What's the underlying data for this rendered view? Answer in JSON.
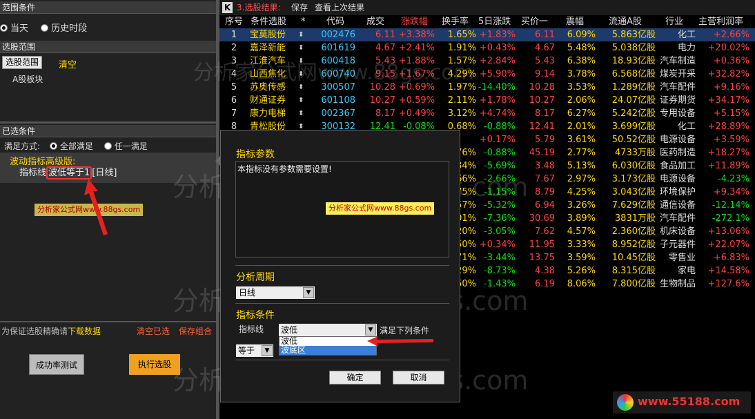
{
  "left": {
    "range_head": "范围条件",
    "range_options": [
      "当天",
      "历史时段"
    ],
    "stock_range_head": "选股范围",
    "stock_range_button": "选股范围",
    "clear_label": "清空",
    "board": "A股板块",
    "selected_head": "已选条件",
    "satisfy_label": "满足方式:",
    "satisfy_options": [
      "全部满足",
      "任一满足"
    ],
    "cond_title": "波动指标高级版:",
    "cond_prefix": "指标线",
    "cond_highlight": "波低等于1",
    "cond_suffix": "[日线]",
    "watermark_tag": "分析家公式网www.88gs.com",
    "note_text": "为保证选股精确请",
    "download_link": "下载数据",
    "clear_selected": "清空已选",
    "save_combo": "保存组合",
    "test_button": "成功率测试",
    "run_button": "执行选股"
  },
  "topbar": {
    "logo": "K",
    "title": "3.选股结果:",
    "save": "保存",
    "last": "查看上次结果"
  },
  "columns": [
    "序号",
    "条件选股",
    "*",
    "代码",
    "成交",
    "涨跌幅",
    "换手率",
    "5日涨跌",
    "买价一",
    "震幅",
    "流通A股",
    "行业",
    "主营利润率"
  ],
  "rows": [
    {
      "n": "1",
      "name": "宝莫股份",
      "code": "002476",
      "price": "6.11",
      "chg": "+3.38%",
      "turn": "1.65%",
      "d5": "+1.83%",
      "bid": "6.11",
      "amp": "6.09%",
      "float": "5.863亿股",
      "ind": "化工",
      "margin": "+2.66%"
    },
    {
      "n": "2",
      "name": "嘉泽新能",
      "code": "601619",
      "price": "4.67",
      "chg": "+2.41%",
      "turn": "1.91%",
      "d5": "+0.43%",
      "bid": "4.67",
      "amp": "5.48%",
      "float": "5.038亿股",
      "ind": "电力",
      "margin": "+20.02%"
    },
    {
      "n": "3",
      "name": "江淮汽车",
      "code": "600418",
      "price": "5.43",
      "chg": "+1.88%",
      "turn": "1.57%",
      "d5": "+2.84%",
      "bid": "5.43",
      "amp": "6.38%",
      "float": "18.93亿股",
      "ind": "汽车制造",
      "margin": "+0.36%"
    },
    {
      "n": "4",
      "name": "山西焦化",
      "code": "600740",
      "price": "9.15",
      "chg": "+1.67%",
      "turn": "4.29%",
      "d5": "+5.90%",
      "bid": "9.14",
      "amp": "3.78%",
      "float": "6.568亿股",
      "ind": "煤炭开采",
      "margin": "+32.82%"
    },
    {
      "n": "5",
      "name": "苏奥传感",
      "code": "300507",
      "price": "10.28",
      "chg": "+0.69%",
      "turn": "1.97%",
      "d5": "-14.40%",
      "bid": "10.28",
      "amp": "3.53%",
      "float": "1.289亿股",
      "ind": "汽车配件",
      "margin": "+9.16%"
    },
    {
      "n": "6",
      "name": "财通证券",
      "code": "601108",
      "price": "10.27",
      "chg": "+0.59%",
      "turn": "2.11%",
      "d5": "+1.78%",
      "bid": "10.27",
      "amp": "2.06%",
      "float": "24.07亿股",
      "ind": "证券期货",
      "margin": "+34.17%"
    },
    {
      "n": "7",
      "name": "康力电梯",
      "code": "002367",
      "price": "8.17",
      "chg": "+0.49%",
      "turn": "3.12%",
      "d5": "+4.74%",
      "bid": "8.17",
      "amp": "6.27%",
      "float": "5.242亿股",
      "ind": "专用设备",
      "margin": "+5.15%"
    },
    {
      "n": "8",
      "name": "青松股份",
      "code": "300132",
      "price": "12.41",
      "chg": "-0.08%",
      "turn": "0.68%",
      "d5": "-0.88%",
      "bid": "12.41",
      "amp": "2.01%",
      "float": "3.699亿股",
      "ind": "化工",
      "margin": "+28.89%"
    },
    {
      "n": "",
      "name": "",
      "code": "",
      "price": "",
      "chg": "",
      "turn": "",
      "d5": "+0.17%",
      "bid": "5.79",
      "amp": "3.61%",
      "float": "50.52亿股",
      "ind": "电源设备",
      "margin": "+3.59%"
    },
    {
      "n": "",
      "name": "",
      "code": "",
      "price": "",
      "chg": "",
      "turn": "76%",
      "d5": "-0.88%",
      "bid": "45.19",
      "amp": "2.77%",
      "float": "4733万股",
      "ind": "医药制造",
      "margin": "+18.27%"
    },
    {
      "n": "",
      "name": "",
      "code": "",
      "price": "",
      "chg": "",
      "turn": "34%",
      "d5": "-5.69%",
      "bid": "3.48",
      "amp": "5.13%",
      "float": "6.030亿股",
      "ind": "食品加工",
      "margin": "+11.89%"
    },
    {
      "n": "",
      "name": "",
      "code": "",
      "price": "",
      "chg": "",
      "turn": "66%",
      "d5": "-2.66%",
      "bid": "7.67",
      "amp": "2.97%",
      "float": "3.173亿股",
      "ind": "电源设备",
      "margin": "-4.23%"
    },
    {
      "n": "",
      "name": "",
      "code": "",
      "price": "",
      "chg": "",
      "turn": "75%",
      "d5": "-1.15%",
      "bid": "8.79",
      "amp": "4.25%",
      "float": "3.043亿股",
      "ind": "环境保护",
      "margin": "+9.34%"
    },
    {
      "n": "",
      "name": "",
      "code": "",
      "price": "",
      "chg": "",
      "turn": "57%",
      "d5": "-5.32%",
      "bid": "6.94",
      "amp": "3.26%",
      "float": "7.629亿股",
      "ind": "通信设备",
      "margin": "-12.14%"
    },
    {
      "n": "",
      "name": "",
      "code": "",
      "price": "",
      "chg": "",
      "turn": "01%",
      "d5": "-7.36%",
      "bid": "30.69",
      "amp": "3.89%",
      "float": "3831万股",
      "ind": "汽车配件",
      "margin": "-272.1%"
    },
    {
      "n": "",
      "name": "",
      "code": "",
      "price": "",
      "chg": "",
      "turn": "20%",
      "d5": "-3.05%",
      "bid": "7.62",
      "amp": "4.57%",
      "float": "2.360亿股",
      "ind": "机床设备",
      "margin": "+13.06%"
    },
    {
      "n": "",
      "name": "",
      "code": "",
      "price": "",
      "chg": "",
      "turn": "50%",
      "d5": "+0.34%",
      "bid": "11.95",
      "amp": "3.33%",
      "float": "8.952亿股",
      "ind": "子元器件",
      "margin": "+22.07%"
    },
    {
      "n": "",
      "name": "",
      "code": "",
      "price": "",
      "chg": "",
      "turn": "71%",
      "d5": "-3.44%",
      "bid": "13.75",
      "amp": "3.59%",
      "float": "10.45亿股",
      "ind": "零售业",
      "margin": "+6.83%"
    },
    {
      "n": "",
      "name": "",
      "code": "",
      "price": "",
      "chg": "",
      "turn": "29%",
      "d5": "-8.73%",
      "bid": "4.38",
      "amp": "5.26%",
      "float": "8.315亿股",
      "ind": "家电",
      "margin": "+14.58%"
    },
    {
      "n": "",
      "name": "",
      "code": "",
      "price": "",
      "chg": "",
      "turn": "50%",
      "d5": "-1.43%",
      "bid": "6.19",
      "amp": "8.06%",
      "float": "7.800亿股",
      "ind": "生物制品",
      "margin": "+127.6%"
    }
  ],
  "dialog": {
    "params_head": "指标参数",
    "params_text": "本指标没有参数需要设置!",
    "watermark_tag": "分析家公式网www.88gs.com",
    "period_head": "分析周期",
    "period_value": "日线",
    "cond_head": "指标条件",
    "line_label": "指标线",
    "line_value": "波低",
    "satisfy_text": "满足下列条件",
    "options": [
      "波低",
      "波底区"
    ],
    "op_value": "等于",
    "ok": "确定",
    "cancel": "取消"
  },
  "watermarks": {
    "big": "分析家公式网www.88gs.com",
    "site": "www.55188.com"
  },
  "colors": {
    "red": "#ff4040",
    "green": "#00e000",
    "cyan": "#33ccff",
    "yellow": "#ffd700",
    "highlight": "#ff3030"
  }
}
